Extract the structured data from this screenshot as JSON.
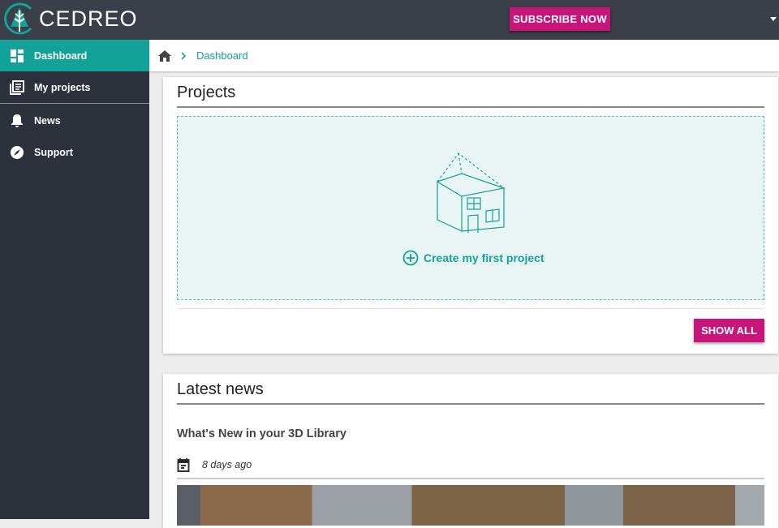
{
  "brand": {
    "name": "CEDREO"
  },
  "header": {
    "subscribe_label": "SUBSCRIBE NOW"
  },
  "sidebar": {
    "items": [
      {
        "label": "Dashboard"
      },
      {
        "label": "My projects"
      },
      {
        "label": "News"
      },
      {
        "label": "Support"
      }
    ]
  },
  "breadcrumb": {
    "current": "Dashboard"
  },
  "projects": {
    "title": "Projects",
    "create_label": "Create my first project",
    "show_all_label": "SHOW ALL"
  },
  "news": {
    "title": "Latest news",
    "article": {
      "title": "What's New in your 3D Library",
      "date": "8 days ago"
    }
  },
  "colors": {
    "accent": "#13a298",
    "brand": "#c8157a",
    "sidebar": "#2d313b"
  }
}
